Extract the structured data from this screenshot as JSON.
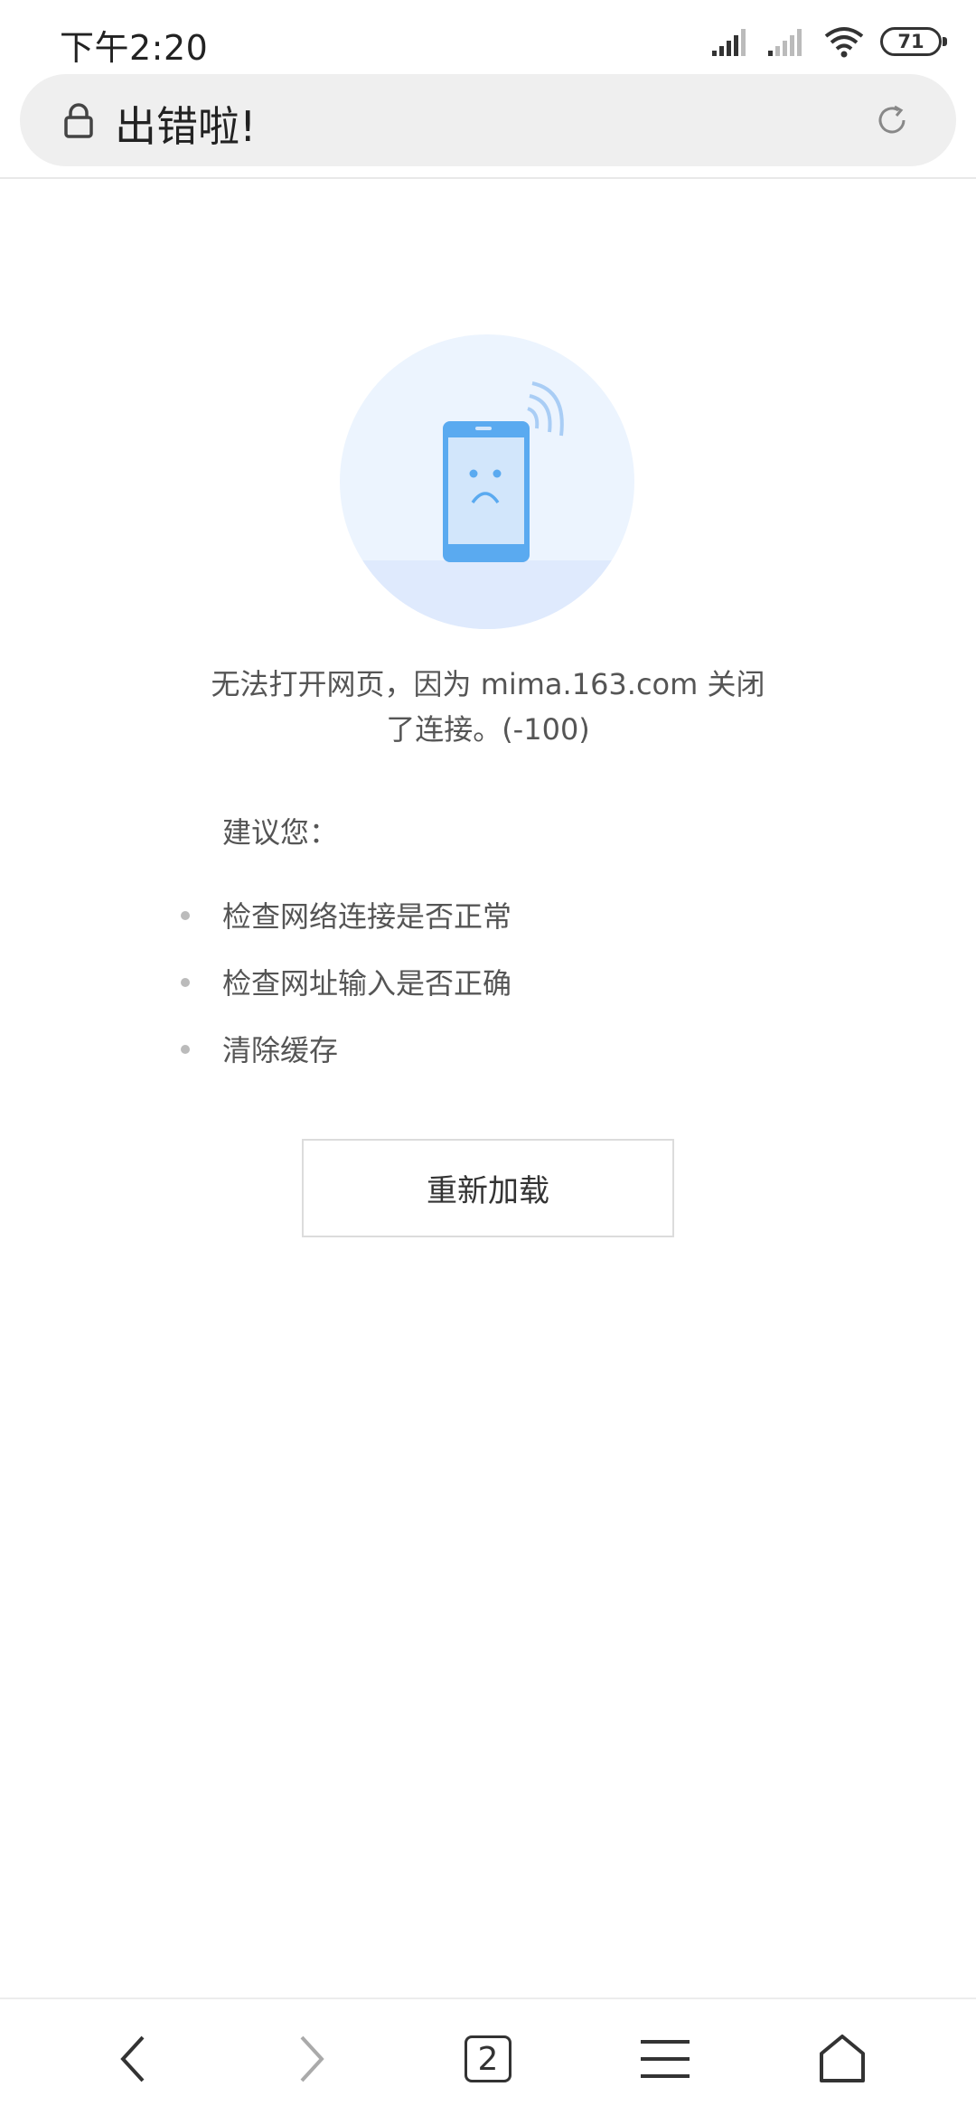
{
  "status_bar": {
    "time": "下午2:20",
    "battery": "71"
  },
  "address_bar": {
    "title": "出错啦!",
    "icons": [
      "lock-icon",
      "reload-icon"
    ]
  },
  "error": {
    "message_line1": "无法打开网页，因为 mima.163.com 关闭",
    "message_line2": "了连接。(-100)",
    "suggestion_title": "建议您：",
    "suggestions": [
      "检查网络连接是否正常",
      "检查网址输入是否正确",
      "清除缓存"
    ],
    "reload_button": "重新加载"
  },
  "bottom_nav": {
    "tab_count": "2",
    "icons": [
      "back-icon",
      "forward-icon",
      "tabs-icon",
      "menu-icon",
      "home-icon"
    ]
  },
  "colors": {
    "illustration_blue": "#5aaaf0",
    "illustration_bg": "#ecf4fe",
    "address_bar_bg": "#efefef"
  }
}
